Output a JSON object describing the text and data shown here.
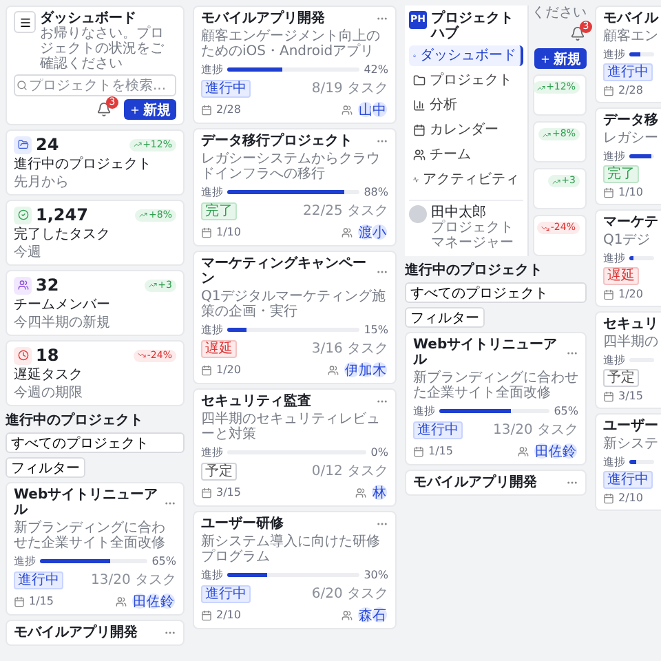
{
  "dashboard": {
    "title": "ダッシュボード",
    "subtitle": "お帰りなさい。プロジェクトの状況をご確認ください",
    "search": {
      "placeholder": "プロジェクトを検索..."
    },
    "notification_count": "3",
    "new_button": "新規",
    "stats": [
      {
        "kind": "projects",
        "value": "24",
        "label": "進行中のプロジェクト",
        "note": "先月から",
        "trend": {
          "kind": "up",
          "text": "+12%"
        }
      },
      {
        "kind": "tasks",
        "value": "1,247",
        "label": "完了したタスク",
        "note": "今週",
        "trend": {
          "kind": "up",
          "text": "+8%"
        }
      },
      {
        "kind": "team",
        "value": "32",
        "label": "チームメンバー",
        "note": "今四半期の新規",
        "trend": {
          "kind": "up",
          "text": "+3"
        }
      },
      {
        "kind": "delayed",
        "value": "18",
        "label": "遅延タスク",
        "note": "今週の期限",
        "trend": {
          "kind": "down",
          "text": "-24%"
        }
      }
    ],
    "section": {
      "title": "進行中のプロジェクト",
      "scope": "すべてのプロジェクト",
      "filter_button": "フィルター",
      "project": {
        "title": "Webサイトリニューアル",
        "description": "新ブランディングに合わせた企業サイト全面改修",
        "progress_label": "進捗",
        "percent": "65%",
        "level": 0.65,
        "kind": "progress",
        "status_label": "進行中",
        "tasks": "13/20 タスク",
        "date": "1/15",
        "members": [
          "田",
          "佐",
          "鈴"
        ]
      },
      "next_title": "モバイルアプリ開発"
    }
  },
  "project_list": {
    "projects": [
      {
        "title": "モバイルアプリ開発",
        "description": "顧客エンゲージメント向上のためのiOS・Androidアプリ",
        "progress_label": "進捗",
        "percent": "42%",
        "level": 0.42,
        "kind": "progress",
        "status_label": "進行中",
        "tasks": "8/19 タスク",
        "date": "2/28",
        "members": [
          "山",
          "中"
        ]
      },
      {
        "title": "データ移行プロジェクト",
        "description": "レガシーシステムからクラウドインフラへの移行",
        "progress_label": "進捗",
        "percent": "88%",
        "level": 0.88,
        "kind": "done",
        "status_label": "完了",
        "tasks": "22/25 タスク",
        "date": "1/10",
        "members": [
          "渡",
          "小"
        ]
      },
      {
        "title": "マーケティングキャンペーン",
        "description": "Q1デジタルマーケティング施策の企画・実行",
        "progress_label": "進捗",
        "percent": "15%",
        "level": 0.15,
        "kind": "late",
        "status_label": "遅延",
        "tasks": "3/16 タスク",
        "date": "1/20",
        "members": [
          "伊",
          "加",
          "木"
        ]
      },
      {
        "title": "セキュリティ監査",
        "description": "四半期のセキュリティレビューと対策",
        "progress_label": "進捗",
        "percent": "0%",
        "level": 0,
        "kind": "planned",
        "status_label": "予定",
        "tasks": "0/12 タスク",
        "date": "3/15",
        "members": [
          "林"
        ]
      },
      {
        "title": "ユーザー研修",
        "description": "新システム導入に向けた研修プログラム",
        "progress_label": "進捗",
        "percent": "30%",
        "level": 0.3,
        "kind": "progress",
        "status_label": "進行中",
        "tasks": "6/20 タスク",
        "date": "2/10",
        "members": [
          "森",
          "石"
        ]
      }
    ]
  },
  "drawer_screen": {
    "brand_mark": "PH",
    "brand": "プロジェクトハブ",
    "nav": [
      {
        "kind": "dashboard",
        "label": "ダッシュボード",
        "selected": true
      },
      {
        "kind": "projects",
        "label": "プロジェクト",
        "selected": false
      },
      {
        "kind": "analytics",
        "label": "分析",
        "selected": false
      },
      {
        "kind": "calendar",
        "label": "カレンダー",
        "selected": false
      },
      {
        "kind": "team",
        "label": "チーム",
        "selected": false
      },
      {
        "kind": "activity",
        "label": "アクティビティ",
        "selected": false
      }
    ],
    "user": {
      "name": "田中太郎",
      "role": "プロジェクトマネージャー"
    },
    "subtitle_tail": "ください",
    "notification_count": "3",
    "new_button": "新規",
    "trends": [
      {
        "kind": "up",
        "text": "+12%"
      },
      {
        "kind": "up",
        "text": "+8%"
      },
      {
        "kind": "up",
        "text": "+3"
      },
      {
        "kind": "down",
        "text": "-24%"
      }
    ],
    "section": {
      "title": "進行中のプロジェクト",
      "scope": "すべてのプロジェクト",
      "filter_button": "フィルター",
      "project": {
        "title": "Webサイトリニューアル",
        "description": "新ブランディングに合わせた企業サイト全面改修",
        "progress_label": "進捗",
        "percent": "65%",
        "level": 0.65,
        "kind": "progress",
        "status_label": "進行中",
        "tasks": "13/20 タスク",
        "date": "1/15",
        "members": [
          "田",
          "佐",
          "鈴"
        ]
      },
      "next_title": "モバイルアプリ開発"
    }
  },
  "project_list_cut": {
    "projects": [
      {
        "title": "モバイル",
        "description": "顧客エン",
        "progress_label": "進捗",
        "level": 0.42,
        "kind": "progress",
        "status_label": "進行中",
        "date": "2/28"
      },
      {
        "title": "データ移",
        "description": "レガシー",
        "progress_label": "進捗",
        "level": 0.88,
        "kind": "done",
        "status_label": "完了",
        "date": "1/10"
      },
      {
        "title": "マーケテ",
        "description": "Q1デジ",
        "progress_label": "進捗",
        "level": 0.15,
        "kind": "late",
        "status_label": "遅延",
        "date": "1/20"
      },
      {
        "title": "セキュリ",
        "description": "四半期の",
        "progress_label": "進捗",
        "level": 0,
        "kind": "planned",
        "status_label": "予定",
        "date": "3/15"
      },
      {
        "title": "ユーザー",
        "description": "新システ",
        "progress_label": "進捗",
        "level": 0.3,
        "kind": "progress",
        "status_label": "進行中",
        "date": "2/10"
      }
    ]
  }
}
